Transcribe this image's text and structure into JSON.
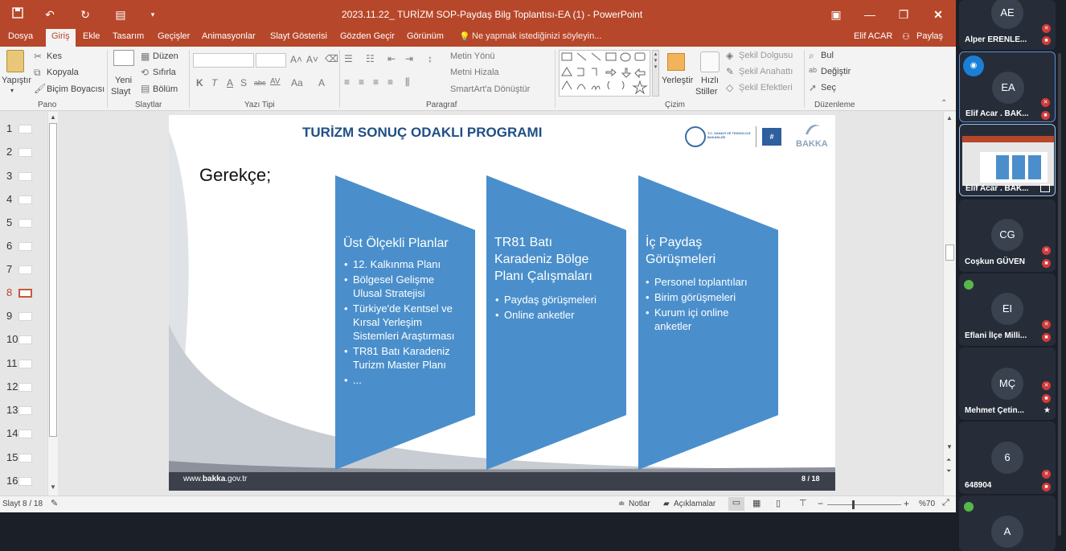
{
  "window": {
    "title": "2023.11.22_ TURİZM SOP-Paydaş Bilg Toplantısı-EA (1) - PowerPoint",
    "user": "Elif ACAR",
    "share": "Paylaş"
  },
  "tabs": [
    "Dosya",
    "Giriş",
    "Ekle",
    "Tasarım",
    "Geçişler",
    "Animasyonlar",
    "Slayt Gösterisi",
    "Gözden Geçir",
    "Görünüm"
  ],
  "tell_me": "Ne yapmak istediğinizi söyleyin...",
  "ribbon": {
    "pano": {
      "label": "Pano",
      "paste": "Yapıştır",
      "cut": "Kes",
      "copy": "Kopyala",
      "format_painter": "Biçim Boyacısı"
    },
    "slaytlar": {
      "label": "Slaytlar",
      "new_slide": "Yeni",
      "new_slide2": "Slayt",
      "layout": "Düzen",
      "reset": "Sıfırla",
      "section": "Bölüm"
    },
    "yazi_tipi": {
      "label": "Yazı Tipi",
      "bold": "K",
      "italic": "T",
      "underline": "A",
      "shadow": "S",
      "strike": "abc",
      "spacing": "AV",
      "case": "Aa",
      "color": "A"
    },
    "paragraf": {
      "label": "Paragraf",
      "text_direction": "Metin Yönü",
      "align_text": "Metni Hizala",
      "smartart": "SmartArt'a Dönüştür"
    },
    "cizim": {
      "label": "Çizim",
      "arrange": "Yerleştir",
      "quick_styles": "Hızlı",
      "quick_styles2": "Stiller",
      "shape_fill": "Şekil Dolgusu",
      "shape_outline": "Şekil Anahattı",
      "shape_effects": "Şekil Efektleri"
    },
    "duzenleme": {
      "label": "Düzenleme",
      "find": "Bul",
      "replace": "Değiştir",
      "select": "Seç"
    }
  },
  "thumbnails": [
    "1",
    "2",
    "3",
    "4",
    "5",
    "6",
    "7",
    "8",
    "9",
    "10",
    "11",
    "12",
    "13",
    "14",
    "15",
    "16"
  ],
  "selected_thumbnail": "8",
  "slide": {
    "title": "TURİZM SONUÇ ODAKLI PROGRAMI",
    "logo_ministry": "T.C. SANAYİ VE TEKNOLOJİ BAKANLIĞI",
    "logo_bakka": "BAKKA",
    "heading": "Gerekçe;",
    "columns": [
      {
        "title": "Üst Ölçekli Planlar",
        "items": [
          "12. Kalkınma Planı",
          "Bölgesel Gelişme Ulusal Stratejisi",
          "Türkiye'de Kentsel ve Kırsal Yerleşim Sistemleri Araştırması",
          "TR81 Batı Karadeniz Turizm Master Planı",
          "..."
        ]
      },
      {
        "title": "TR81 Batı Karadeniz Bölge Planı Çalışmaları",
        "items": [
          "Paydaş görüşmeleri",
          "Online anketler"
        ]
      },
      {
        "title": "İç Paydaş Görüşmeleri",
        "items": [
          "Personel toplantıları",
          "Birim görüşmeleri",
          "Kurum içi online anketler"
        ]
      }
    ],
    "footer_prefix": "www.",
    "footer_bold": "bakka",
    "footer_suffix": ".gov.tr",
    "page": "8 / 18",
    "chevron_color": "#4a8fcb"
  },
  "status": {
    "slide_counter": "Slayt 8 / 18",
    "notes": "Notlar",
    "comments": "Açıklamalar",
    "zoom": "%70",
    "zoom_level": 0.7
  },
  "participants": [
    {
      "initials": "AE",
      "name": "Alper ERENLE..."
    },
    {
      "initials": "EA",
      "name": "Elif Acar . BAK..."
    },
    {
      "initials": "",
      "name": "Elif Acar . BAK..."
    },
    {
      "initials": "CG",
      "name": "Coşkun GÜVEN"
    },
    {
      "initials": "EI",
      "name": "Eflani İlçe Milli..."
    },
    {
      "initials": "MÇ",
      "name": "Mehmet Çetin..."
    },
    {
      "initials": "6",
      "name": "648904"
    },
    {
      "initials": "A",
      "name": ""
    }
  ]
}
